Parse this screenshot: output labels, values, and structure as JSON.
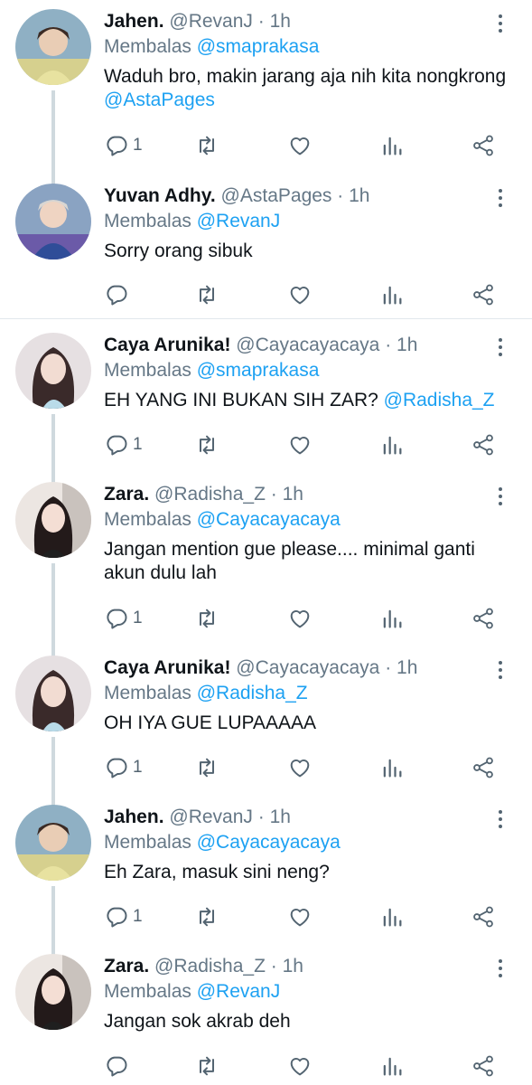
{
  "tweets": [
    {
      "name": "Jahen.",
      "handle": "@RevanJ",
      "time": "1h",
      "replying_label": "Membalas",
      "replying_to": "@smaprakasa",
      "text": "Waduh bro, makin jarang aja nih kita nongkrong ",
      "mention": "@AstaPages",
      "reply_count": "1",
      "avatar_color": "#9fb8c9"
    },
    {
      "name": "Yuvan Adhy.",
      "handle": "@AstaPages",
      "time": "1h",
      "replying_label": "Membalas",
      "replying_to": "@RevanJ",
      "text": "Sorry orang sibuk",
      "mention": "",
      "reply_count": "",
      "avatar_color": "#3a5fa6"
    },
    {
      "name": "Caya Arunika!",
      "handle": "@Cayacayacaya",
      "time": "1h",
      "replying_label": "Membalas",
      "replying_to": "@smaprakasa",
      "text": "EH YANG INI BUKAN SIH ZAR? ",
      "mention": "@Radisha_Z",
      "reply_count": "1",
      "avatar_color": "#d8cfd1"
    },
    {
      "name": "Zara.",
      "handle": "@Radisha_Z",
      "time": "1h",
      "replying_label": "Membalas",
      "replying_to": "@Cayacayacaya",
      "text": "Jangan mention gue please.... minimal ganti akun dulu lah",
      "mention": "",
      "reply_count": "1",
      "avatar_color": "#e4dcd8"
    },
    {
      "name": "Caya Arunika!",
      "handle": "@Cayacayacaya",
      "time": "1h",
      "replying_label": "Membalas",
      "replying_to": "@Radisha_Z",
      "text": "OH IYA GUE LUPAAAAA",
      "mention": "",
      "reply_count": "1",
      "avatar_color": "#d8cfd1"
    },
    {
      "name": "Jahen.",
      "handle": "@RevanJ",
      "time": "1h",
      "replying_label": "Membalas",
      "replying_to": "@Cayacayacaya",
      "text": "Eh Zara, masuk sini neng?",
      "mention": "",
      "reply_count": "1",
      "avatar_color": "#9fb8c9"
    },
    {
      "name": "Zara.",
      "handle": "@Radisha_Z",
      "time": "1h",
      "replying_label": "Membalas",
      "replying_to": "@RevanJ",
      "text": "Jangan sok akrab deh",
      "mention": "",
      "reply_count": "",
      "avatar_color": "#e4dcd8"
    }
  ],
  "separator": "·",
  "icons": {
    "reply": "reply-icon",
    "retweet": "retweet-icon",
    "like": "like-icon",
    "stats": "stats-icon",
    "share": "share-icon",
    "more": "more-options-icon"
  },
  "colors": {
    "accent": "#1da1f2",
    "muted": "#657786",
    "text": "#0f1419"
  }
}
